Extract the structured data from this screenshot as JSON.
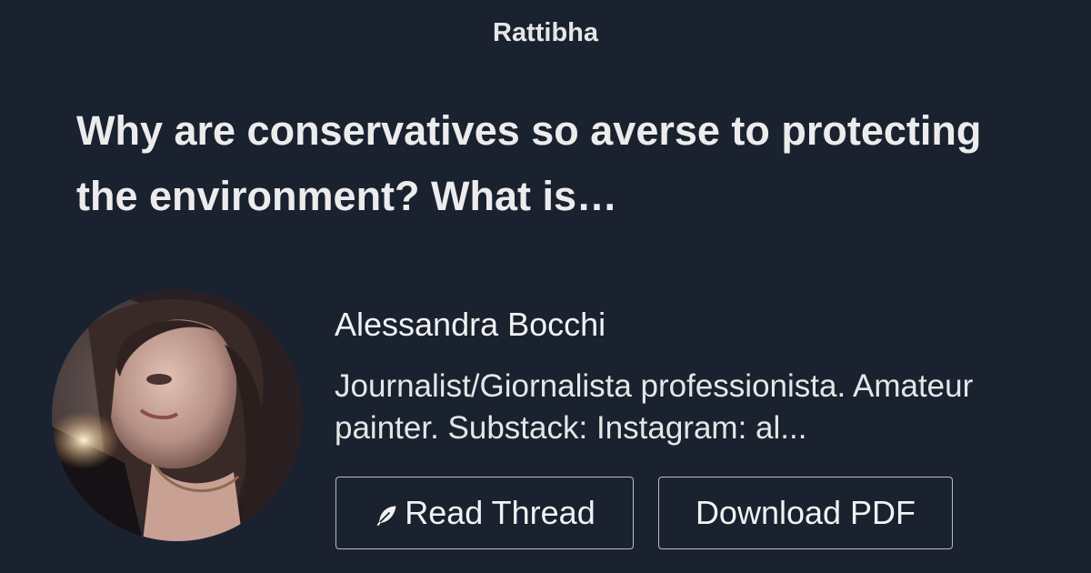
{
  "site": {
    "brand": "Rattibha"
  },
  "thread": {
    "title": "Why are conservatives so averse to protecting the environment? What is…"
  },
  "author": {
    "name": "Alessandra Bocchi",
    "bio": "Journalist/Giornalista professionista. Amateur painter. Substack: Instagram: al..."
  },
  "buttons": {
    "read_label": "Read Thread",
    "download_label": "Download PDF"
  },
  "icons": {
    "read_icon": "feather-icon",
    "avatar": "author-avatar-photo"
  },
  "colors": {
    "background": "#1a2230",
    "text": "#ececec",
    "button_border": "#b9bec6"
  }
}
